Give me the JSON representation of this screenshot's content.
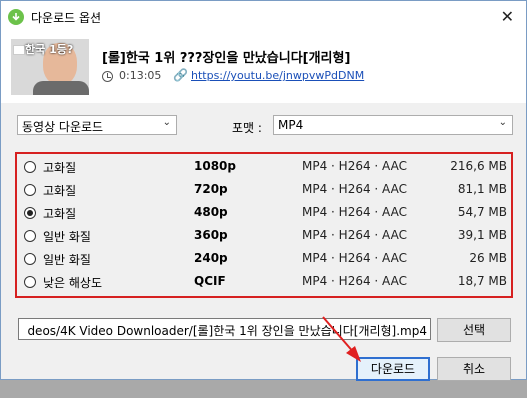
{
  "window": {
    "title": "다운로드 옵션",
    "close": "✕"
  },
  "video": {
    "thumb_text": "한국 1등?",
    "title": "[롤]한국 1위 ???장인을 만났습니다[개리형]",
    "duration": "0:13:05",
    "url": "https://youtu.be/jnwpvwPdDNM"
  },
  "download_type": {
    "selected": "동영상 다운로드"
  },
  "format": {
    "label": "포맷 :",
    "selected": "MP4"
  },
  "qualities": [
    {
      "quality": "고화질",
      "resolution": "1080p",
      "codec": "MP4 · H264 · AAC",
      "size": "216,6 MB",
      "selected": false
    },
    {
      "quality": "고화질",
      "resolution": "720p",
      "codec": "MP4 · H264 · AAC",
      "size": "81,1 MB",
      "selected": false
    },
    {
      "quality": "고화질",
      "resolution": "480p",
      "codec": "MP4 · H264 · AAC",
      "size": "54,7 MB",
      "selected": true
    },
    {
      "quality": "일반 화질",
      "resolution": "360p",
      "codec": "MP4 · H264 · AAC",
      "size": "39,1 MB",
      "selected": false
    },
    {
      "quality": "일반 화질",
      "resolution": "240p",
      "codec": "MP4 · H264 · AAC",
      "size": "26 MB",
      "selected": false
    },
    {
      "quality": "낮은 해상도",
      "resolution": "QCIF",
      "codec": "MP4 · H264 · AAC",
      "size": "18,7 MB",
      "selected": false
    }
  ],
  "save_path": "deos/4K Video Downloader/[롤]한국 1위 장인을 만났습니다[개리형].mp4",
  "buttons": {
    "browse": "선택",
    "download": "다운로드",
    "cancel": "취소"
  },
  "colors": {
    "highlight_border": "#d62020",
    "arrow": "#e02020",
    "default_button": "#2f6fd0"
  }
}
